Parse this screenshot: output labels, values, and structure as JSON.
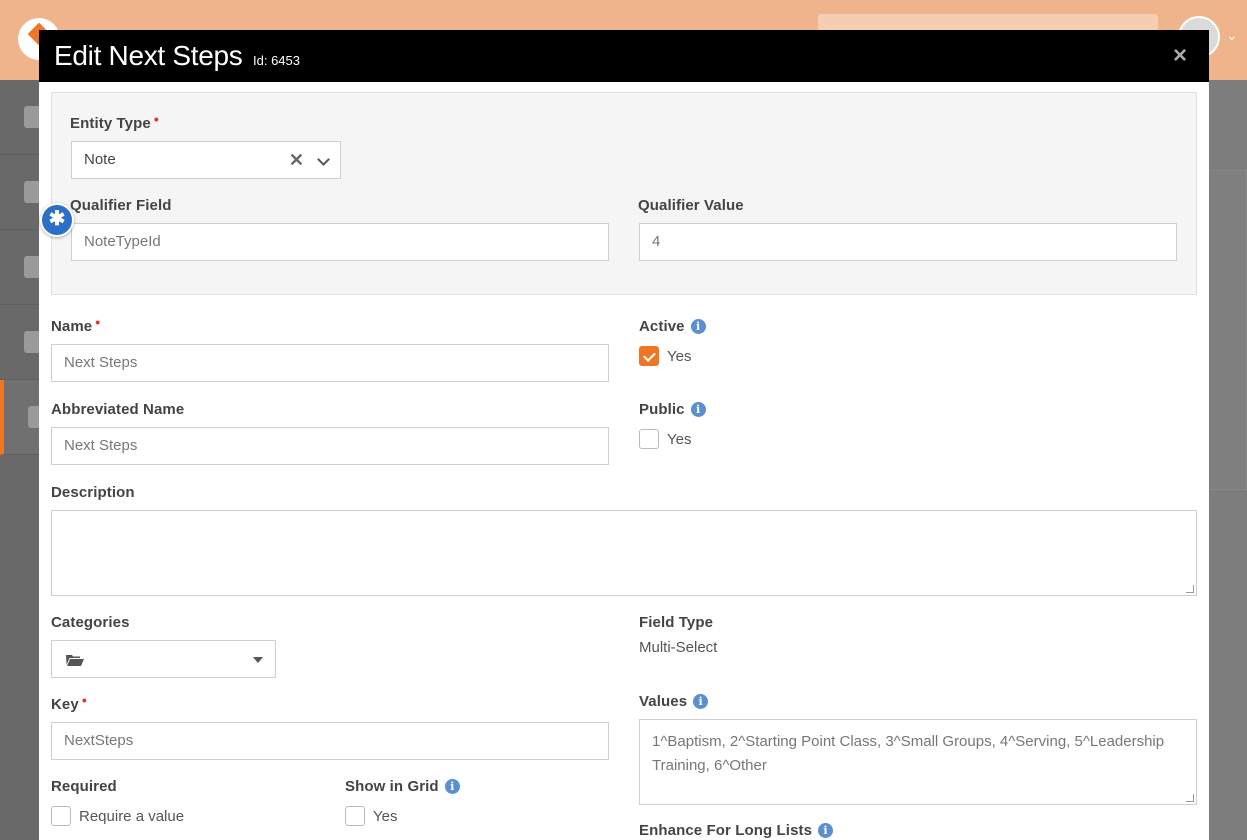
{
  "modal": {
    "title": "Edit Next Steps",
    "id_text": "Id: 6453",
    "close_glyph": "×"
  },
  "qualifier": {
    "entity_type_label": "Entity Type",
    "entity_type_value": "Note",
    "clear_glyph": "✕",
    "qualifier_field_label": "Qualifier Field",
    "qualifier_field_placeholder": "NoteTypeId",
    "qualifier_value_label": "Qualifier Value",
    "qualifier_value": "4"
  },
  "form": {
    "name_label": "Name",
    "name_placeholder": "Next Steps",
    "active_label": "Active",
    "active_checked": true,
    "active_option": "Yes",
    "abbrev_label": "Abbreviated Name",
    "abbrev_placeholder": "Next Steps",
    "public_label": "Public",
    "public_checked": false,
    "public_option": "Yes",
    "description_label": "Description",
    "description_value": "",
    "categories_label": "Categories",
    "field_type_label": "Field Type",
    "field_type_value": "Multi-Select",
    "key_label": "Key",
    "key_placeholder": "NextSteps",
    "values_label": "Values",
    "values_value": "1^Baptism, 2^Starting Point Class, 3^Small Groups, 4^Serving, 5^Leadership Training, 6^Other",
    "required_label": "Required",
    "required_option": "Require a value",
    "required_checked": false,
    "show_in_grid_label": "Show in Grid",
    "show_in_grid_option": "Yes",
    "show_in_grid_checked": false,
    "enhance_label": "Enhance For Long Lists"
  },
  "icons": {
    "info": "info-icon",
    "fab": "asterisk-icon",
    "folder": "folder-open-icon"
  },
  "colors": {
    "header_bg": "#efb48c",
    "accent": "#ee7624",
    "info": "#5a8fd0",
    "required": "#d9382b",
    "fab": "#2b6fc6"
  }
}
